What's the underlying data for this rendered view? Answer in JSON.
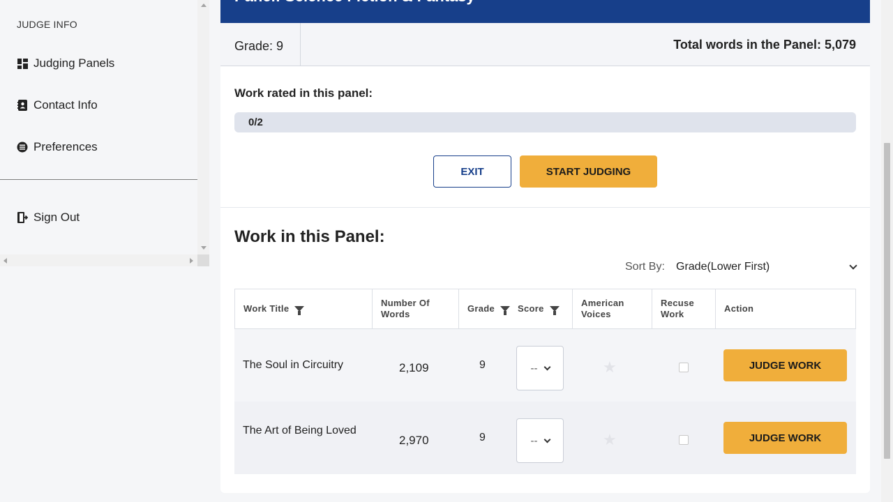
{
  "sidebar": {
    "heading": "JUDGE INFO",
    "items": [
      {
        "label": "Judging Panels",
        "icon": "dashboard-icon"
      },
      {
        "label": "Contact Info",
        "icon": "contact-book-icon"
      },
      {
        "label": "Preferences",
        "icon": "preferences-icon"
      }
    ],
    "signout": {
      "label": "Sign Out",
      "icon": "sign-out-icon"
    }
  },
  "panel": {
    "title": "Panel: Science Fiction & Fantasy",
    "grade": "Grade: 9",
    "total_words": "Total words in the Panel: 5,079",
    "rated_label": "Work rated in this panel:",
    "progress_text": "0/2",
    "progress_fraction": 0,
    "exit_label": "EXIT",
    "start_label": "START JUDGING"
  },
  "works": {
    "heading": "Work in this Panel:",
    "sort_label": "Sort By:",
    "sort_value": "Grade(Lower First)",
    "columns": {
      "title": "Work Title",
      "words": "Number Of Words",
      "grade": "Grade",
      "score": "Score",
      "voices": "American Voices",
      "recuse": "Recuse Work",
      "action": "Action"
    },
    "rows": [
      {
        "title": "The Soul in Circuitry",
        "words": "2,109",
        "grade": "9",
        "score": "--",
        "action": "JUDGE WORK",
        "starred": false,
        "recused": false
      },
      {
        "title": "The Art of Being Loved",
        "words": "2,970",
        "grade": "9",
        "score": "--",
        "action": "JUDGE WORK",
        "starred": false,
        "recused": false
      }
    ]
  },
  "colors": {
    "primary": "#173f8a",
    "accent": "#f0ae3b",
    "background": "#f5f6f8"
  }
}
